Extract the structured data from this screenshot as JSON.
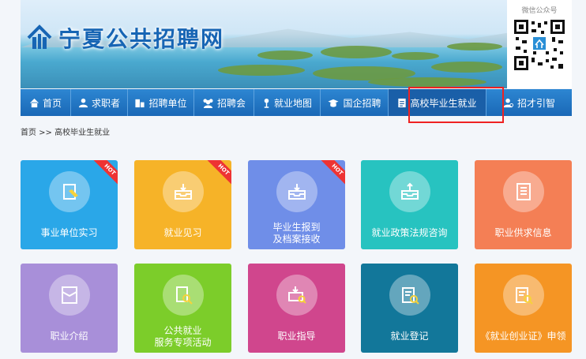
{
  "site": {
    "title": "宁夏公共招聘网",
    "qr_label": "微信公众号"
  },
  "nav": [
    {
      "label": "首页",
      "icon": "home-icon"
    },
    {
      "label": "求职者",
      "icon": "user-icon"
    },
    {
      "label": "招聘单位",
      "icon": "building-icon"
    },
    {
      "label": "招聘会",
      "icon": "group-icon"
    },
    {
      "label": "就业地图",
      "icon": "map-pin-icon"
    },
    {
      "label": "国企招聘",
      "icon": "graduation-cap-icon"
    },
    {
      "label": "高校毕业生就业",
      "icon": "document-icon"
    },
    {
      "label": "招才引智",
      "icon": "talent-icon"
    }
  ],
  "breadcrumb": "首页 >> 高校毕业生就业",
  "tiles": [
    {
      "label": "事业单位实习",
      "hot": "HOT",
      "color": "#2aa7e8",
      "icon": "document-pencil-icon"
    },
    {
      "label": "就业见习",
      "hot": "HOT",
      "color": "#f6b328",
      "icon": "inbox-tray-icon"
    },
    {
      "label": "毕业生报到\n及档案接收",
      "hot": "HOT",
      "color": "#6f8ee8",
      "icon": "inbox-tray-icon"
    },
    {
      "label": "就业政策法规咨询",
      "hot": "",
      "color": "#27c3c0",
      "icon": "upload-tray-icon"
    },
    {
      "label": "职业供求信息",
      "hot": "",
      "color": "#f47f55",
      "icon": "list-document-icon"
    },
    {
      "label": "职业介绍",
      "hot": "",
      "color": "#a88fd9",
      "icon": "envelope-icon"
    },
    {
      "label": "公共就业\n服务专项活动",
      "hot": "",
      "color": "#7ccd2a",
      "icon": "document-search-icon"
    },
    {
      "label": "职业指导",
      "hot": "",
      "color": "#d0468d",
      "icon": "tray-search-icon"
    },
    {
      "label": "就业登记",
      "hot": "",
      "color": "#12779a",
      "icon": "list-search-icon"
    },
    {
      "label": "《就业创业证》申领",
      "hot": "",
      "color": "#f59524",
      "icon": "list-search-icon"
    }
  ]
}
